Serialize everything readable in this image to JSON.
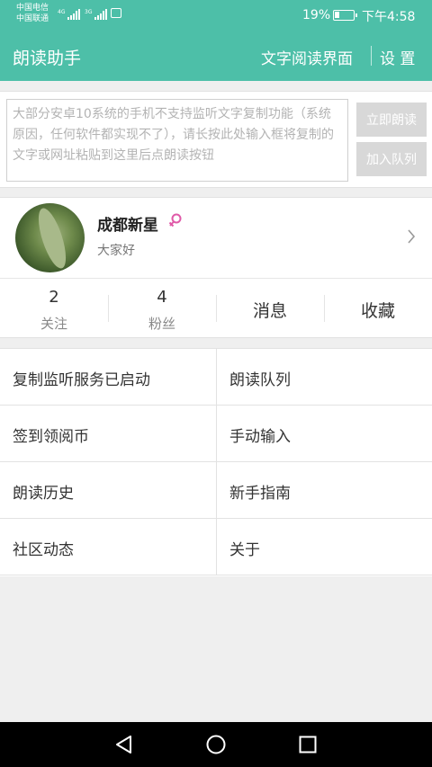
{
  "status_bar": {
    "carrier_1": "中国电信",
    "carrier_2": "中国联通",
    "signal_1": "4G",
    "signal_2": "3G",
    "battery_percent": "19%",
    "time": "下午4:58"
  },
  "app_bar": {
    "title": "朗读助手",
    "text_reading_label": "文字阅读界面",
    "settings_label": "设 置"
  },
  "input_panel": {
    "placeholder": "大部分安卓10系统的手机不支持监听文字复制功能（系统原因，任何软件都实现不了），请长按此处输入框将复制的文字或网址粘贴到这里后点朗读按钮",
    "read_now_label": "立即朗读",
    "add_queue_label": "加入队列"
  },
  "profile": {
    "name": "成都新星",
    "signature": "大家好",
    "gender_icon": "female-icon"
  },
  "stats": {
    "following_count": "2",
    "following_label": "关注",
    "followers_count": "4",
    "followers_label": "粉丝",
    "messages_label": "消息",
    "favorites_label": "收藏"
  },
  "menu": [
    {
      "label": "复制监听服务已启动"
    },
    {
      "label": "朗读队列"
    },
    {
      "label": "签到领阅币"
    },
    {
      "label": "手动输入"
    },
    {
      "label": "朗读历史"
    },
    {
      "label": "新手指南"
    },
    {
      "label": "社区动态"
    },
    {
      "label": "关于"
    }
  ],
  "colors": {
    "primary": "#4dbfa8",
    "disabled_button": "#d8d8d8",
    "female_icon": "#e05aa8"
  },
  "nav_bar": {
    "icons": [
      "back-icon",
      "home-icon",
      "recents-icon"
    ]
  }
}
